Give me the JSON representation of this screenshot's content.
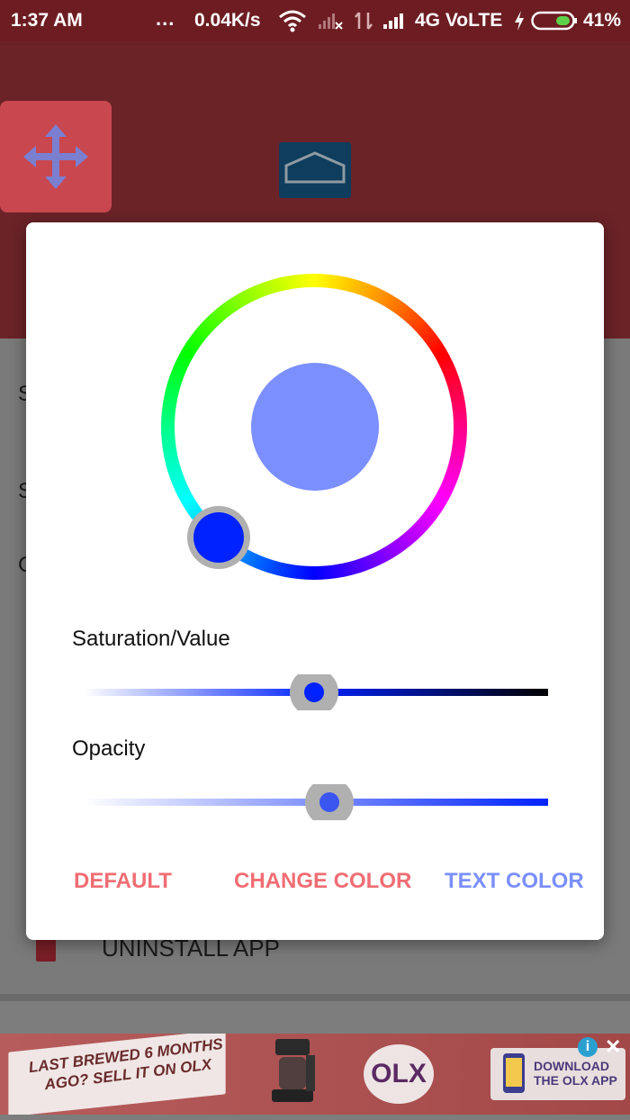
{
  "status_bar": {
    "time": "1:37 AM",
    "dots": "...",
    "speed": "0.04K/s",
    "network": "4G VoLTE",
    "battery": "41%"
  },
  "header": {
    "move_icon": "move-arrows-icon",
    "home_icon": "home-icon"
  },
  "background": {
    "letters": [
      "S",
      "S",
      "C"
    ],
    "uninstall_label": "UNINSTALL APP"
  },
  "dialog": {
    "saturation_label": "Saturation/Value",
    "opacity_label": "Opacity",
    "saturation_value": 0.5,
    "opacity_value": 0.53,
    "selected_hue_color": "#0022ff",
    "preview_color": "#7b8ffe",
    "buttons": {
      "default": "DEFAULT",
      "change_color": "CHANGE COLOR",
      "text_color": "TEXT COLOR"
    },
    "colors": {
      "default_button": "#f06d74",
      "change_color_button": "#f06d74",
      "text_color_button": "#7b8ffe"
    }
  },
  "ad": {
    "left_text": "LAST BREWED 6 MONTHS AGO? SELL IT ON OLX",
    "logo": "OLX",
    "download_text": "DOWNLOAD THE OLX APP"
  }
}
